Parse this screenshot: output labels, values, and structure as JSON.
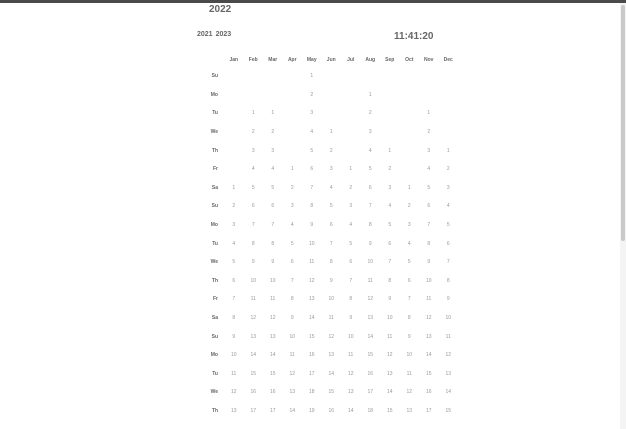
{
  "year": "2022",
  "nav": {
    "prev": "2021",
    "next": "2023"
  },
  "clock": "11:41:20",
  "months": [
    "Jan",
    "Feb",
    "Mar",
    "Apr",
    "May",
    "Jun",
    "Jul",
    "Aug",
    "Sep",
    "Oct",
    "Nov",
    "Dec"
  ],
  "rows": [
    {
      "dow": "Su",
      "cells": [
        "",
        "",
        "",
        "",
        "1",
        "",
        "",
        "",
        "",
        "",
        "",
        ""
      ]
    },
    {
      "dow": "Mo",
      "cells": [
        "",
        "",
        "",
        "",
        "2",
        "",
        "",
        "1",
        "",
        "",
        "",
        ""
      ]
    },
    {
      "dow": "Tu",
      "cells": [
        "",
        "1",
        "1",
        "",
        "3",
        "",
        "",
        "2",
        "",
        "",
        "1",
        ""
      ]
    },
    {
      "dow": "We",
      "cells": [
        "",
        "2",
        "2",
        "",
        "4",
        "1",
        "",
        "3",
        "",
        "",
        "2",
        ""
      ]
    },
    {
      "dow": "Th",
      "cells": [
        "",
        "3",
        "3",
        "",
        "5",
        "2",
        "",
        "4",
        "1",
        "",
        "3",
        "1"
      ]
    },
    {
      "dow": "Fr",
      "cells": [
        "",
        "4",
        "4",
        "1",
        "6",
        "3",
        "1",
        "5",
        "2",
        "",
        "4",
        "2"
      ]
    },
    {
      "dow": "Sa",
      "cells": [
        "1",
        "5",
        "5",
        "2",
        "7",
        "4",
        "2",
        "6",
        "3",
        "1",
        "5",
        "3"
      ]
    },
    {
      "dow": "Su",
      "cells": [
        "2",
        "6",
        "6",
        "3",
        "8",
        "5",
        "3",
        "7",
        "4",
        "2",
        "6",
        "4"
      ]
    },
    {
      "dow": "Mo",
      "cells": [
        "3",
        "7",
        "7",
        "4",
        "9",
        "6",
        "4",
        "8",
        "5",
        "3",
        "7",
        "5"
      ]
    },
    {
      "dow": "Tu",
      "cells": [
        "4",
        "8",
        "8",
        "5",
        "10",
        "7",
        "5",
        "9",
        "6",
        "4",
        "8",
        "6"
      ]
    },
    {
      "dow": "We",
      "cells": [
        "5",
        "9",
        "9",
        "6",
        "11",
        "8",
        "6",
        "10",
        "7",
        "5",
        "9",
        "7"
      ]
    },
    {
      "dow": "Th",
      "cells": [
        "6",
        "10",
        "10",
        "7",
        "12",
        "9",
        "7",
        "11",
        "8",
        "6",
        "10",
        "8"
      ]
    },
    {
      "dow": "Fr",
      "cells": [
        "7",
        "11",
        "11",
        "8",
        "13",
        "10",
        "8",
        "12",
        "9",
        "7",
        "11",
        "9"
      ]
    },
    {
      "dow": "Sa",
      "cells": [
        "8",
        "12",
        "12",
        "9",
        "14",
        "11",
        "9",
        "13",
        "10",
        "8",
        "12",
        "10"
      ]
    },
    {
      "dow": "Su",
      "cells": [
        "9",
        "13",
        "13",
        "10",
        "15",
        "12",
        "10",
        "14",
        "11",
        "9",
        "13",
        "11"
      ]
    },
    {
      "dow": "Mo",
      "cells": [
        "10",
        "14",
        "14",
        "11",
        "16",
        "13",
        "11",
        "15",
        "12",
        "10",
        "14",
        "12"
      ]
    },
    {
      "dow": "Tu",
      "cells": [
        "11",
        "15",
        "15",
        "12",
        "17",
        "14",
        "12",
        "16",
        "13",
        "11",
        "15",
        "13"
      ]
    },
    {
      "dow": "We",
      "cells": [
        "12",
        "16",
        "16",
        "13",
        "18",
        "15",
        "13",
        "17",
        "14",
        "12",
        "16",
        "14"
      ]
    },
    {
      "dow": "Th",
      "cells": [
        "13",
        "17",
        "17",
        "14",
        "19",
        "16",
        "14",
        "18",
        "15",
        "13",
        "17",
        "15"
      ]
    }
  ]
}
